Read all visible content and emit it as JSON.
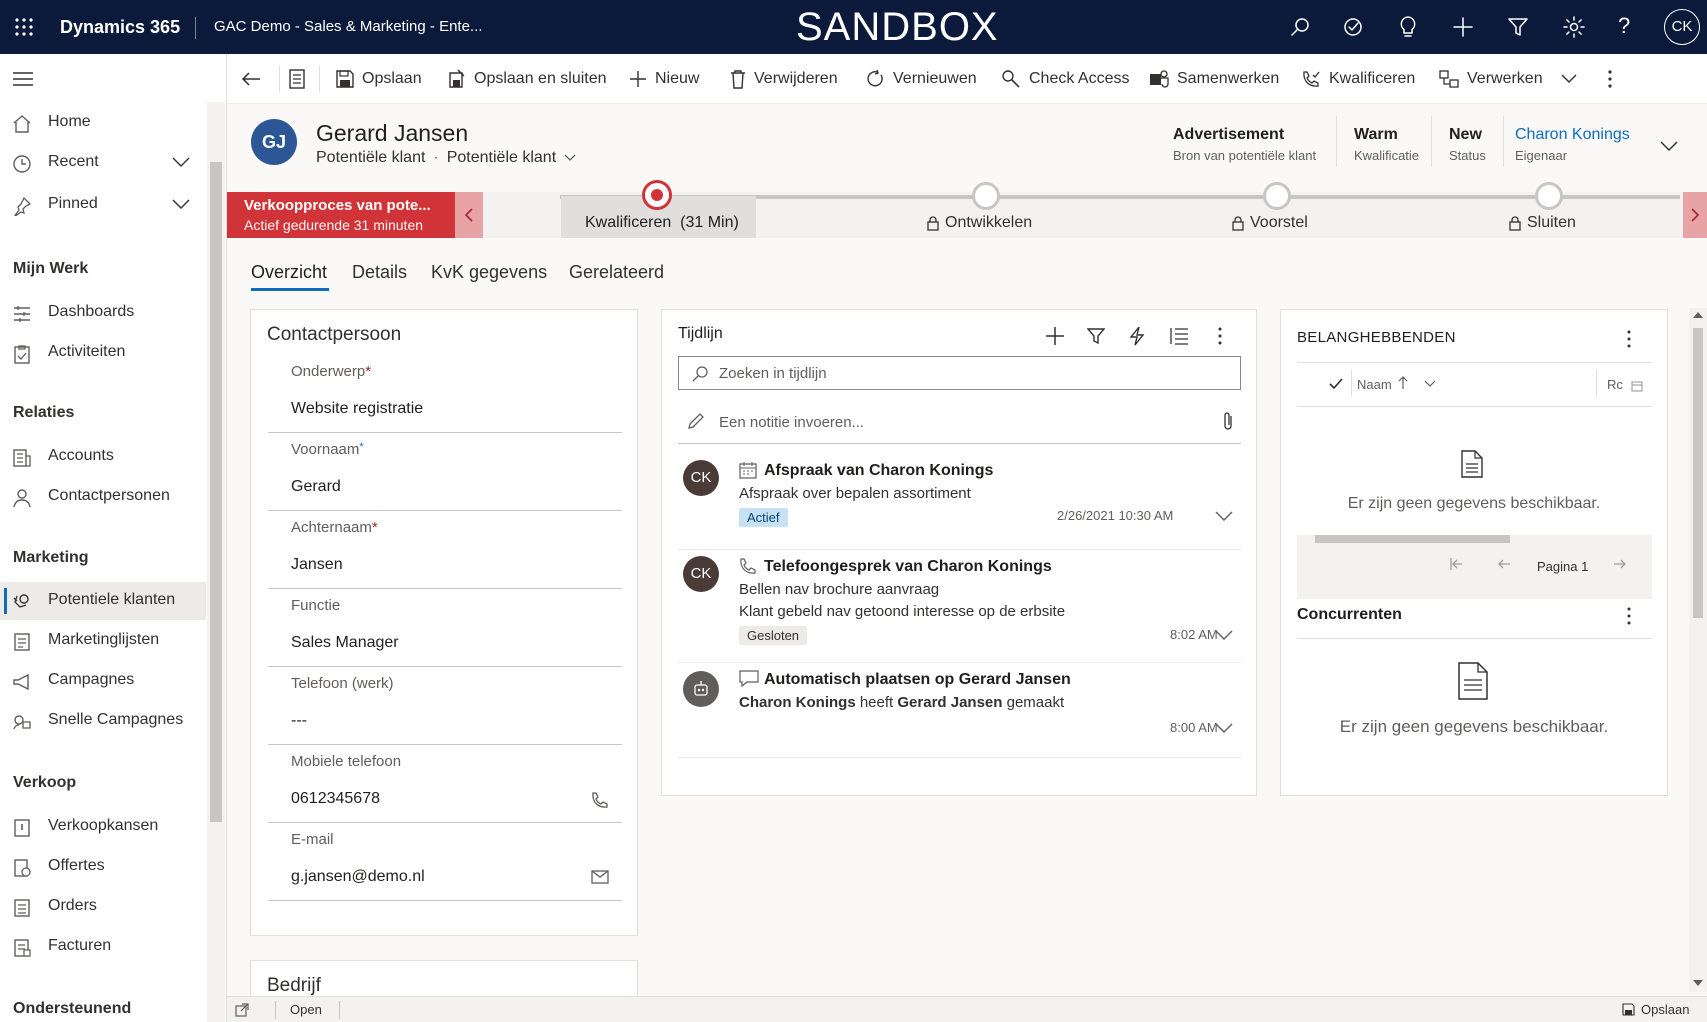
{
  "topbar": {
    "app_name": "Dynamics 365",
    "app_context": "GAC Demo - Sales & Marketing - Ente...",
    "environment_banner": "SANDBOX",
    "user_initials": "CK"
  },
  "commands": {
    "save": "Opslaan",
    "save_close": "Opslaan en sluiten",
    "new": "Nieuw",
    "delete": "Verwijderen",
    "refresh": "Vernieuwen",
    "check_access": "Check Access",
    "collaborate": "Samenwerken",
    "qualify": "Kwalificeren",
    "process": "Verwerken"
  },
  "sidebar": {
    "items_top": [
      {
        "label": "Home",
        "icon": "home-icon"
      },
      {
        "label": "Recent",
        "icon": "clock-icon"
      },
      {
        "label": "Pinned",
        "icon": "pin-icon"
      }
    ],
    "groups": {
      "my_work": "Mijn Werk",
      "relations": "Relaties",
      "marketing": "Marketing",
      "sales": "Verkoop",
      "support": "Ondersteunend"
    },
    "my_work_items": [
      "Dashboards",
      "Activiteiten"
    ],
    "relations_items": [
      "Accounts",
      "Contactpersonen"
    ],
    "marketing_items": [
      "Potentiele klanten",
      "Marketinglijsten",
      "Campagnes",
      "Snelle Campagnes"
    ],
    "sales_items": [
      "Verkoopkansen",
      "Offertes",
      "Orders",
      "Facturen"
    ]
  },
  "record": {
    "initials": "GJ",
    "name": "Gerard Jansen",
    "entity": "Potentiële klant",
    "form": "Potentiële klant",
    "header_fields": [
      {
        "value": "Advertisement",
        "label": "Bron van potentiële klant"
      },
      {
        "value": "Warm",
        "label": "Kwalificatie"
      },
      {
        "value": "New",
        "label": "Status"
      },
      {
        "value": "Charon Konings",
        "label": "Eigenaar"
      }
    ]
  },
  "process": {
    "name": "Verkoopproces van pote...",
    "duration": "Actief gedurende 31 minuten",
    "stages": [
      {
        "label": "Kwalificeren  (31 Min)",
        "active": true
      },
      {
        "label": "Ontwikkelen",
        "active": false
      },
      {
        "label": "Voorstel",
        "active": false
      },
      {
        "label": "Sluiten",
        "active": false
      }
    ]
  },
  "tabs": [
    "Overzicht",
    "Details",
    "KvK gegevens",
    "Gerelateerd"
  ],
  "contact": {
    "title": "Contactpersoon",
    "fields": [
      {
        "label": "Onderwerp",
        "required": "*",
        "value": "Website registratie"
      },
      {
        "label": "Voornaam",
        "required": "*",
        "value": "Gerard"
      },
      {
        "label": "Achternaam",
        "required": "*",
        "value": "Jansen"
      },
      {
        "label": "Functie",
        "required": "",
        "value": "Sales Manager"
      },
      {
        "label": "Telefoon (werk)",
        "required": "",
        "value": "---"
      },
      {
        "label": "Mobiele telefoon",
        "required": "",
        "value": "0612345678"
      },
      {
        "label": "E-mail",
        "required": "",
        "value": "g.jansen@demo.nl"
      }
    ]
  },
  "company": {
    "title": "Bedrijf"
  },
  "timeline": {
    "title": "Tijdlijn",
    "search_placeholder": "Zoeken in tijdlijn",
    "note_placeholder": "Een notitie invoeren...",
    "items": [
      {
        "avatar": "CK",
        "title": "Afspraak van Charon Konings",
        "line1": "Afspraak over bepalen assortiment",
        "line2": "",
        "badge": "Actief",
        "time": "2/26/2021 10:30 AM"
      },
      {
        "avatar": "CK",
        "title": "Telefoongesprek van Charon Konings",
        "line1": "Bellen nav brochure aanvraag",
        "line2": "Klant gebeld nav getoond interesse op de erbsite",
        "badge": "Gesloten",
        "time": "8:02 AM"
      },
      {
        "avatar": "",
        "title": "Automatisch plaatsen op Gerard Jansen",
        "line1_a": "Charon Konings",
        "line1_b": " heeft ",
        "line1_c": "Gerard Jansen",
        "line1_d": " gemaakt",
        "time": "8:00 AM"
      }
    ]
  },
  "stakeholders": {
    "title": "BELANGHEBBENDEN",
    "col_name": "Naam",
    "col_role": "Rc",
    "empty": "Er zijn geen gegevens beschikbaar.",
    "page": "Pagina 1"
  },
  "competitors": {
    "title": "Concurrenten",
    "empty": "Er zijn geen gegevens beschikbaar."
  },
  "statusbar": {
    "open": "Open",
    "save": "Opslaan"
  }
}
